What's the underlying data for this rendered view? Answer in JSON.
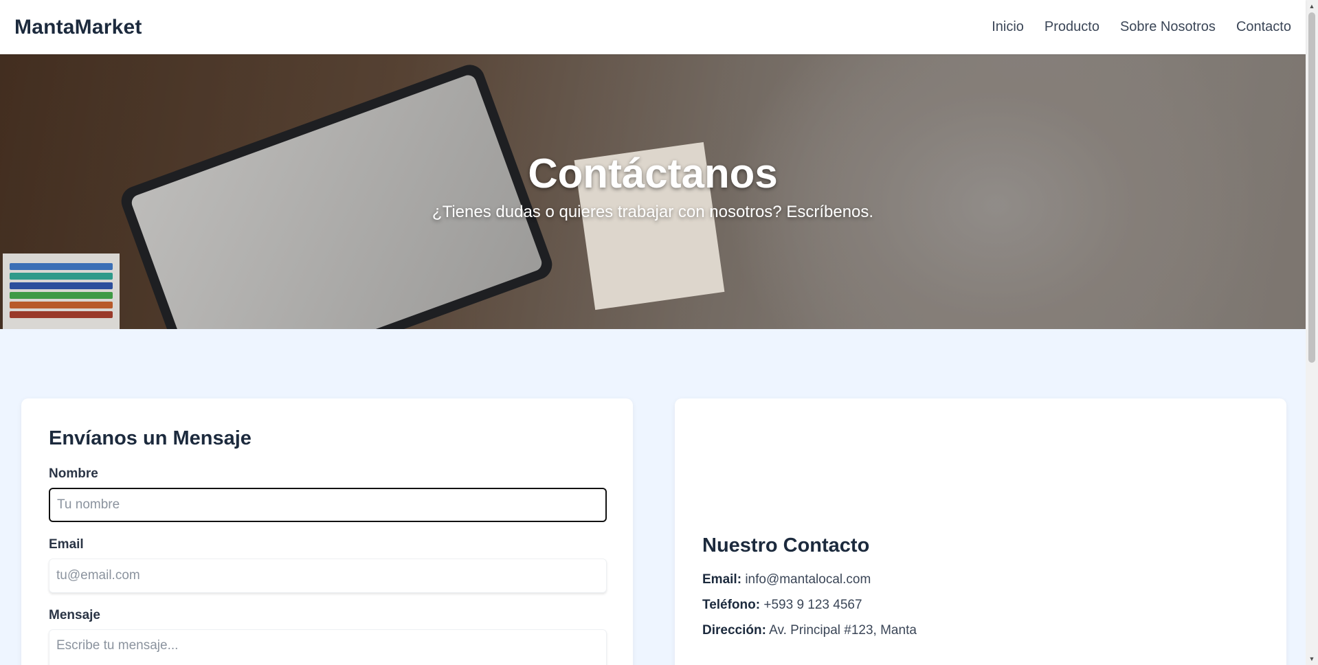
{
  "nav": {
    "brand": "MantaMarket",
    "links": [
      "Inicio",
      "Producto",
      "Sobre Nosotros",
      "Contacto"
    ]
  },
  "hero": {
    "title": "Contáctanos",
    "subtitle": "¿Tienes dudas o quieres trabajar con nosotros? Escríbenos."
  },
  "form": {
    "title": "Envíanos un Mensaje",
    "fields": [
      {
        "label": "Nombre",
        "placeholder": "Tu nombre",
        "value": ""
      },
      {
        "label": "Email",
        "placeholder": "tu@email.com",
        "value": ""
      },
      {
        "label": "Mensaje",
        "placeholder": "Escribe tu mensaje...",
        "value": ""
      }
    ]
  },
  "contact": {
    "title": "Nuestro Contacto",
    "rows": [
      {
        "label": "Email:",
        "value": "info@mantalocal.com"
      },
      {
        "label": "Teléfono:",
        "value": "+593 9 123 4567"
      },
      {
        "label": "Dirección:",
        "value": "Av. Principal #123, Manta"
      }
    ]
  },
  "colors": {
    "page_background": "#eef5ff",
    "heading": "#1c2a3d",
    "card": "#ffffff"
  },
  "icons": {
    "scroll_up": "scroll-up-arrow-icon",
    "scroll_down": "scroll-down-arrow-icon"
  }
}
